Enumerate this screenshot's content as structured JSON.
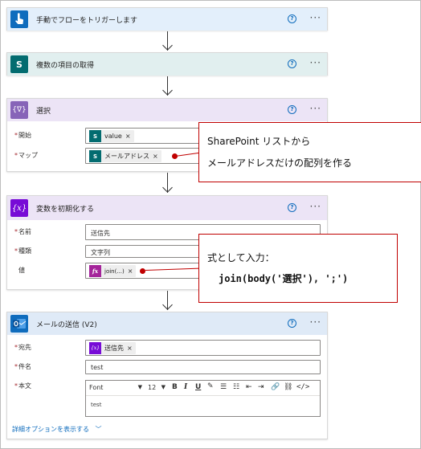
{
  "steps": {
    "trigger": {
      "title": "手動でフローをトリガーします",
      "color": "#0f6cbd"
    },
    "get_items": {
      "title": "複数の項目の取得",
      "color": "#036c70",
      "icon_text": "S"
    },
    "select": {
      "title": "選択",
      "color": "#8764b8",
      "icon_text": "{∇}",
      "fields": [
        {
          "label": "開始",
          "required": true,
          "token": "value",
          "token_icon": "S",
          "token_color": "#036c70"
        },
        {
          "label": "マップ",
          "required": true,
          "token": "メールアドレス",
          "token_icon": "S",
          "token_color": "#036c70"
        }
      ]
    },
    "init_var": {
      "title": "変数を初期化する",
      "color": "#770bd6",
      "icon_text": "{x}",
      "fields": [
        {
          "label": "名前",
          "required": true,
          "value": "送信先"
        },
        {
          "label": "種類",
          "required": true,
          "value": "文字列"
        },
        {
          "label": "値",
          "required": false,
          "token": "join(...)",
          "token_icon": "fx",
          "token_color": "#a4249a"
        }
      ]
    },
    "send_mail": {
      "title": "メールの送信 (V2)",
      "color": "#0f6cbd",
      "fields": [
        {
          "label": "宛先",
          "required": true,
          "token": "送信先",
          "token_icon": "{x}",
          "token_color": "#770bd6"
        },
        {
          "label": "件名",
          "required": true,
          "value": "test"
        },
        {
          "label": "本文",
          "required": true,
          "body": "test"
        }
      ],
      "editor": {
        "font": "Font",
        "size": "12"
      },
      "advanced_link": "詳細オプションを表示する"
    }
  },
  "callouts": {
    "select": {
      "line1": "SharePoint リストから",
      "line2": "メールアドレスだけの配列を作る"
    },
    "init": {
      "line1": "式として入力：",
      "code": "join(body('選択'), ';')"
    }
  },
  "icons": {
    "help": "?",
    "more": "···",
    "remove": "×"
  }
}
